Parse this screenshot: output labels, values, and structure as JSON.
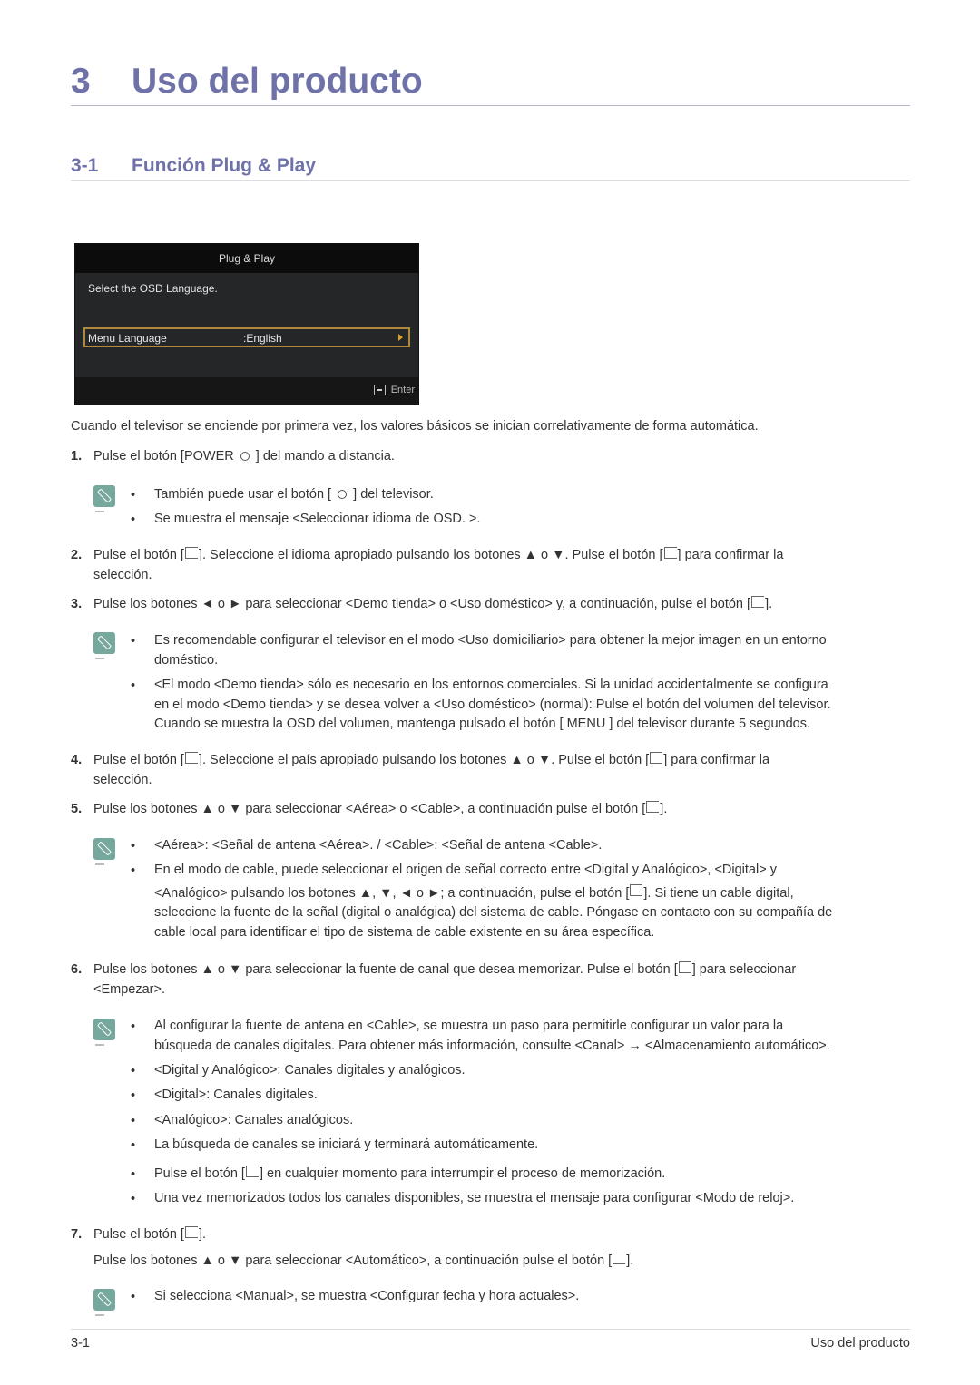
{
  "chapter": {
    "number": "3",
    "title": "Uso del producto"
  },
  "section": {
    "number": "3-1",
    "title": "Función Plug & Play"
  },
  "osd": {
    "header": "Plug & Play",
    "prompt": "Select the OSD Language.",
    "row_label": "Menu Language",
    "row_value": ":English",
    "footer_icon": "enter-icon",
    "footer_label": "Enter",
    "highlight_color": "#b08a3c"
  },
  "intro": "Cuando el televisor se enciende por primera vez, los valores básicos se inician correlativamente de forma automática.",
  "steps": [
    {
      "num": "1.",
      "lines": [
        "Pulse el botón [POWER ⏻ ] del mando a distancia."
      ],
      "notes": [
        [
          "También puede usar el botón [ ⏻ ] del televisor."
        ],
        [
          "Se muestra el mensaje <Seleccionar idioma de OSD. >."
        ]
      ]
    },
    {
      "num": "2.",
      "lines": [
        "Pulse el botón [⏎]. Seleccione el idioma apropiado pulsando los botones ▲ o ▼. Pulse el botón [⏎] para confirmar la",
        "selección."
      ]
    },
    {
      "num": "3.",
      "lines": [
        "Pulse los botones ◄ o ► para seleccionar <Demo tienda> o <Uso doméstico> y, a continuación, pulse el botón [⏎]."
      ],
      "notes": [
        [
          "Es recomendable configurar el televisor en el modo <Uso domiciliario> para obtener la mejor imagen en un entorno",
          "doméstico."
        ],
        [
          "<El modo <Demo tienda> sólo es necesario en los entornos comerciales. Si la unidad accidentalmente se configura",
          "en el modo <Demo tienda> y se desea volver a <Uso doméstico> (normal): Pulse el botón del volumen del televisor.",
          "Cuando se muestra la OSD del volumen, mantenga pulsado el botón [ MENU ] del televisor durante 5 segundos."
        ]
      ]
    },
    {
      "num": "4.",
      "lines": [
        "Pulse el botón [⏎]. Seleccione el país apropiado pulsando los botones ▲ o ▼. Pulse el botón [⏎] para confirmar la",
        "selección."
      ]
    },
    {
      "num": "5.",
      "lines": [
        "Pulse los botones ▲ o ▼ para seleccionar <Aérea> o <Cable>, a continuación pulse el botón [⏎]."
      ],
      "notes": [
        [
          "<Aérea>: <Señal de antena <Aérea>. / <Cable>: <Señal de antena <Cable>."
        ],
        [
          "En el modo de cable, puede seleccionar el origen de señal correcto entre <Digital y Analógico>, <Digital> y",
          "<Analógico> pulsando los botones ▲, ▼, ◄ o ►; a continuación, pulse el botón [⏎]. Si tiene un cable digital,",
          "seleccione la fuente de la señal (digital o analógica) del sistema de cable. Póngase en contacto con su compañía de",
          "cable local para identificar el tipo de sistema de cable existente en su área específica."
        ]
      ]
    },
    {
      "num": "6.",
      "lines": [
        "Pulse los botones ▲ o ▼ para seleccionar la fuente de canal que desea memorizar. Pulse el botón [⏎] para seleccionar",
        "<Empezar>."
      ],
      "notes": [
        [
          "Al configurar la fuente de antena en <Cable>, se muestra un paso para permitirle configurar un valor para la",
          "búsqueda de canales digitales. Para obtener más información, consulte <Canal> → <Almacenamiento automático>."
        ],
        [
          "<Digital y Analógico>: Canales digitales y analógicos."
        ],
        [
          "<Digital>: Canales digitales."
        ],
        [
          "<Analógico>: Canales analógicos."
        ],
        [
          "La búsqueda de canales se iniciará y terminará automáticamente."
        ],
        [
          "Pulse el botón [⏎] en cualquier momento para interrumpir el proceso de memorización."
        ],
        [
          "Una vez memorizados todos los canales disponibles, se muestra el mensaje para configurar <Modo de reloj>."
        ]
      ]
    },
    {
      "num": "7.",
      "lines": [
        "Pulse el botón [⏎].",
        "Pulse los botones ▲ o ▼ para seleccionar <Automático>, a continuación pulse el botón [⏎]."
      ],
      "notes": [
        [
          "Si selecciona <Manual>, se muestra <Configurar fecha y hora actuales>."
        ]
      ]
    }
  ],
  "footer": {
    "page": "3-1",
    "chapter": "Uso del producto"
  },
  "colors": {
    "heading": "#6e72a8",
    "note_icon": "#76a89e",
    "body_text": "#333333"
  }
}
